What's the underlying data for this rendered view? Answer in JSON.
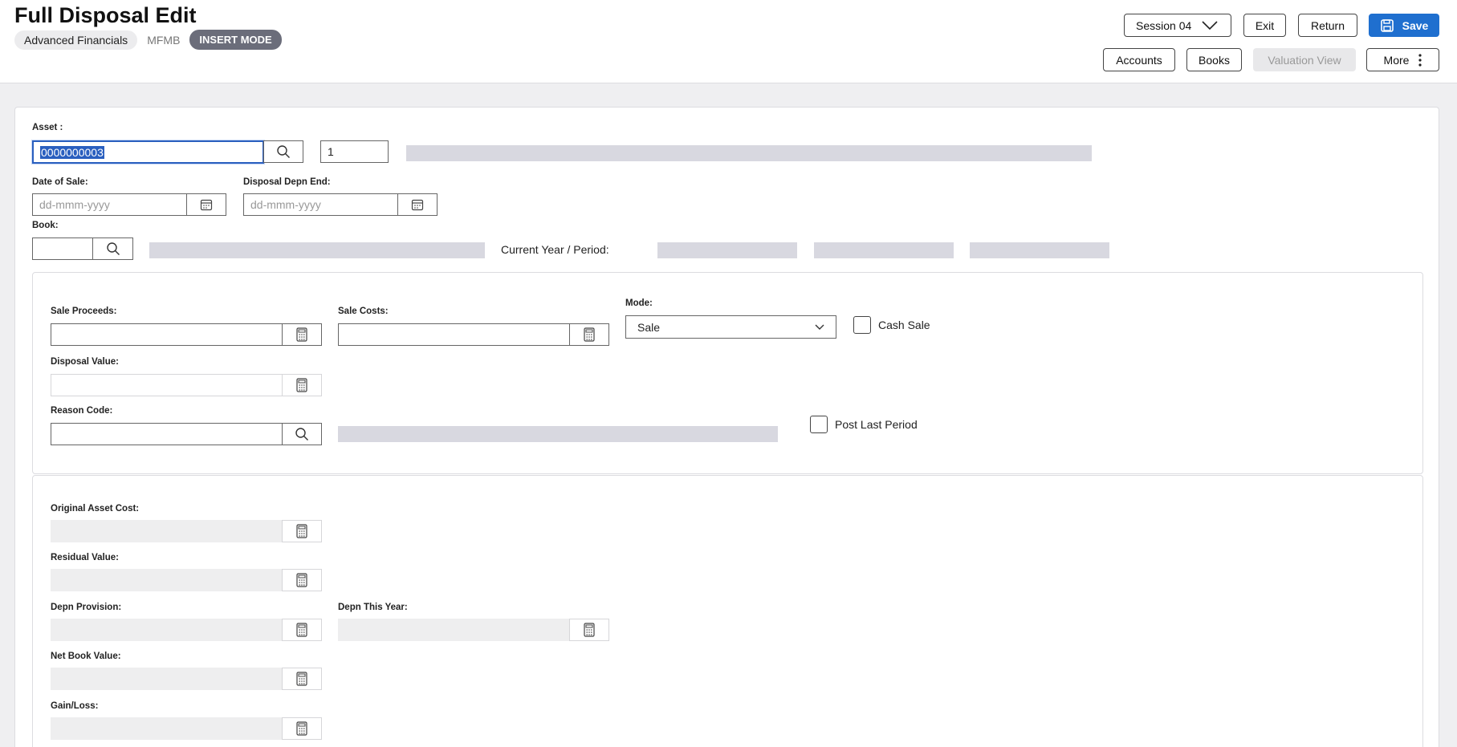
{
  "header": {
    "title": "Full Disposal Edit",
    "product": "Advanced Financials",
    "code": "MFMB",
    "mode": "INSERT MODE"
  },
  "toolbar": {
    "session": "Session 04",
    "exit": "Exit",
    "return": "Return",
    "save": "Save",
    "accounts": "Accounts",
    "books": "Books",
    "valuation_view": "Valuation View",
    "more": "More"
  },
  "form": {
    "asset_label": "Asset :",
    "asset_value": "0000000003",
    "asset_seq": "1",
    "date_of_sale_label": "Date of Sale:",
    "date_of_sale_placeholder": "dd-mmm-yyyy",
    "disposal_depn_end_label": "Disposal Depn End:",
    "disposal_depn_end_placeholder": "dd-mmm-yyyy",
    "book_label": "Book:",
    "current_year_period_label": "Current Year / Period:"
  },
  "sale": {
    "sale_proceeds_label": "Sale Proceeds:",
    "sale_costs_label": "Sale Costs:",
    "mode_label": "Mode:",
    "mode_value": "Sale",
    "cash_sale_label": "Cash Sale",
    "disposal_value_label": "Disposal Value:",
    "reason_code_label": "Reason Code:",
    "post_last_period_label": "Post Last Period"
  },
  "values": {
    "original_asset_cost_label": "Original Asset Cost:",
    "residual_value_label": "Residual Value:",
    "depn_provision_label": "Depn Provision:",
    "depn_this_year_label": "Depn This Year:",
    "net_book_value_label": "Net Book Value:",
    "gain_loss_label": "Gain/Loss:"
  },
  "colors": {
    "primary": "#1f6fcf",
    "mode_chip": "#6b6d7a",
    "selection": "#2a5fbf"
  }
}
